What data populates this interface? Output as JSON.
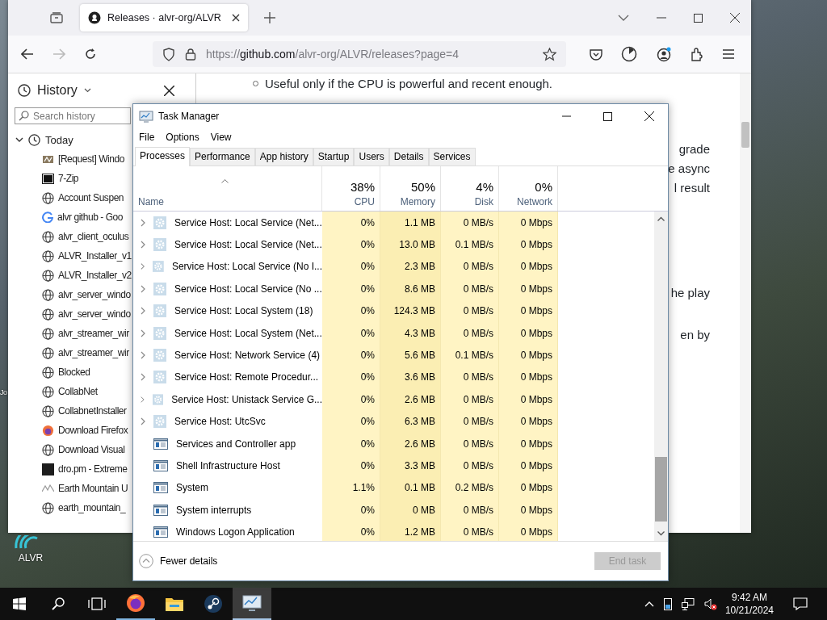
{
  "desktop": {
    "icons": [
      {
        "label": "Jo",
        "kind": "hidden"
      },
      {
        "label": "ALVR",
        "kind": "wifi"
      }
    ]
  },
  "browser": {
    "tab": {
      "title": "Releases · alvr-org/ALVR"
    },
    "forward": {
      "disabled": true
    },
    "url": {
      "scheme": "https://",
      "host": "github.com",
      "path": "/alvr-org/ALVR/releases?page=4"
    },
    "sidebar": {
      "title": "History",
      "search": {
        "placeholder": "Search history"
      },
      "tree": [
        {
          "label": "Today",
          "expanded": true,
          "children": [
            {
              "label": "[Request] Windo",
              "kind": "request"
            },
            {
              "label": "7-Zip",
              "kind": "zip"
            },
            {
              "label": "Account Suspen",
              "kind": "globe"
            },
            {
              "label": "alvr github - Goo",
              "kind": "google"
            },
            {
              "label": "alvr_client_oculus",
              "kind": "globe"
            },
            {
              "label": "ALVR_Installer_v1",
              "kind": "globe"
            },
            {
              "label": "ALVR_Installer_v2",
              "kind": "globe"
            },
            {
              "label": "alvr_server_windo",
              "kind": "globe"
            },
            {
              "label": "alvr_server_windo",
              "kind": "globe"
            },
            {
              "label": "alvr_streamer_wir",
              "kind": "globe"
            },
            {
              "label": "alvr_streamer_wir",
              "kind": "globe"
            },
            {
              "label": "Blocked",
              "kind": "globe"
            },
            {
              "label": "CollabNet",
              "kind": "globe"
            },
            {
              "label": "CollabnetInstaller",
              "kind": "globe"
            },
            {
              "label": "Download Firefox",
              "kind": "firefox"
            },
            {
              "label": "Download Visual",
              "kind": "globe"
            },
            {
              "label": "dro.pm - Extreme",
              "kind": "dark"
            },
            {
              "label": "Earth Mountain U",
              "kind": "earth"
            },
            {
              "label": "earth_mountain_",
              "kind": "globe"
            }
          ]
        }
      ]
    },
    "content": {
      "bullet": "Useful only if the CPU is powerful and recent enough.",
      "fragments": [
        "grade",
        "e async",
        "l result",
        "he play",
        "en by"
      ]
    }
  },
  "task_manager": {
    "title": "Task Manager",
    "menu": [
      "File",
      "Options",
      "View"
    ],
    "tabs": [
      {
        "label": "Processes",
        "selected": true
      },
      {
        "label": "Performance",
        "selected": false
      },
      {
        "label": "App history",
        "selected": false
      },
      {
        "label": "Startup",
        "selected": false
      },
      {
        "label": "Users",
        "selected": false
      },
      {
        "label": "Details",
        "selected": false
      },
      {
        "label": "Services",
        "selected": false
      }
    ],
    "columns": [
      {
        "label": "Name"
      },
      {
        "label": "CPU",
        "total": "38%"
      },
      {
        "label": "Memory",
        "total": "50%"
      },
      {
        "label": "Disk",
        "total": "4%"
      },
      {
        "label": "Network",
        "total": "0%"
      }
    ],
    "rows": [
      {
        "kind": "service",
        "name": "Service Host: Local Service (Net...",
        "cpu": "0%",
        "memory": "1.1 MB",
        "disk": "0 MB/s",
        "network": "0 Mbps"
      },
      {
        "kind": "service",
        "name": "Service Host: Local Service (Net...",
        "cpu": "0%",
        "memory": "13.0 MB",
        "disk": "0.1 MB/s",
        "network": "0 Mbps"
      },
      {
        "kind": "service",
        "name": "Service Host: Local Service (No I...",
        "cpu": "0%",
        "memory": "2.3 MB",
        "disk": "0 MB/s",
        "network": "0 Mbps"
      },
      {
        "kind": "service",
        "name": "Service Host: Local Service (No ...",
        "cpu": "0%",
        "memory": "8.6 MB",
        "disk": "0 MB/s",
        "network": "0 Mbps"
      },
      {
        "kind": "service",
        "name": "Service Host: Local System (18)",
        "cpu": "0%",
        "memory": "124.3 MB",
        "disk": "0 MB/s",
        "network": "0 Mbps"
      },
      {
        "kind": "service",
        "name": "Service Host: Local System (Net...",
        "cpu": "0%",
        "memory": "4.3 MB",
        "disk": "0 MB/s",
        "network": "0 Mbps"
      },
      {
        "kind": "service",
        "name": "Service Host: Network Service (4)",
        "cpu": "0%",
        "memory": "5.6 MB",
        "disk": "0.1 MB/s",
        "network": "0 Mbps"
      },
      {
        "kind": "service",
        "name": "Service Host: Remote Procedur...",
        "cpu": "0%",
        "memory": "3.6 MB",
        "disk": "0 MB/s",
        "network": "0 Mbps"
      },
      {
        "kind": "service",
        "name": "Service Host: Unistack Service G...",
        "cpu": "0%",
        "memory": "2.6 MB",
        "disk": "0 MB/s",
        "network": "0 Mbps"
      },
      {
        "kind": "service",
        "name": "Service Host: UtcSvc",
        "cpu": "0%",
        "memory": "6.3 MB",
        "disk": "0 MB/s",
        "network": "0 Mbps"
      },
      {
        "kind": "app",
        "name": "Services and Controller app",
        "cpu": "0%",
        "memory": "2.6 MB",
        "disk": "0 MB/s",
        "network": "0 Mbps"
      },
      {
        "kind": "app",
        "name": "Shell Infrastructure Host",
        "cpu": "0%",
        "memory": "3.3 MB",
        "disk": "0 MB/s",
        "network": "0 Mbps"
      },
      {
        "kind": "app",
        "name": "System",
        "cpu": "1.1%",
        "memory": "0.1 MB",
        "disk": "0.2 MB/s",
        "network": "0 Mbps"
      },
      {
        "kind": "app",
        "name": "System interrupts",
        "cpu": "0%",
        "memory": "0 MB",
        "disk": "0 MB/s",
        "network": "0 Mbps"
      },
      {
        "kind": "app",
        "name": "Windows Logon Application",
        "cpu": "0%",
        "memory": "1.2 MB",
        "disk": "0 MB/s",
        "network": "0 Mbps"
      }
    ],
    "footer": {
      "toggle": "Fewer details",
      "end_task": {
        "label": "End task",
        "disabled": true
      }
    }
  },
  "taskbar": {
    "apps": [
      {
        "kind": "firefox",
        "running": true,
        "active": false
      },
      {
        "kind": "explorer",
        "running": false,
        "active": false
      },
      {
        "kind": "steam",
        "running": false,
        "active": false
      },
      {
        "kind": "taskmgr",
        "running": false,
        "active": true
      }
    ],
    "clock": {
      "time": "9:42 AM",
      "date": "10/21/2024"
    }
  }
}
